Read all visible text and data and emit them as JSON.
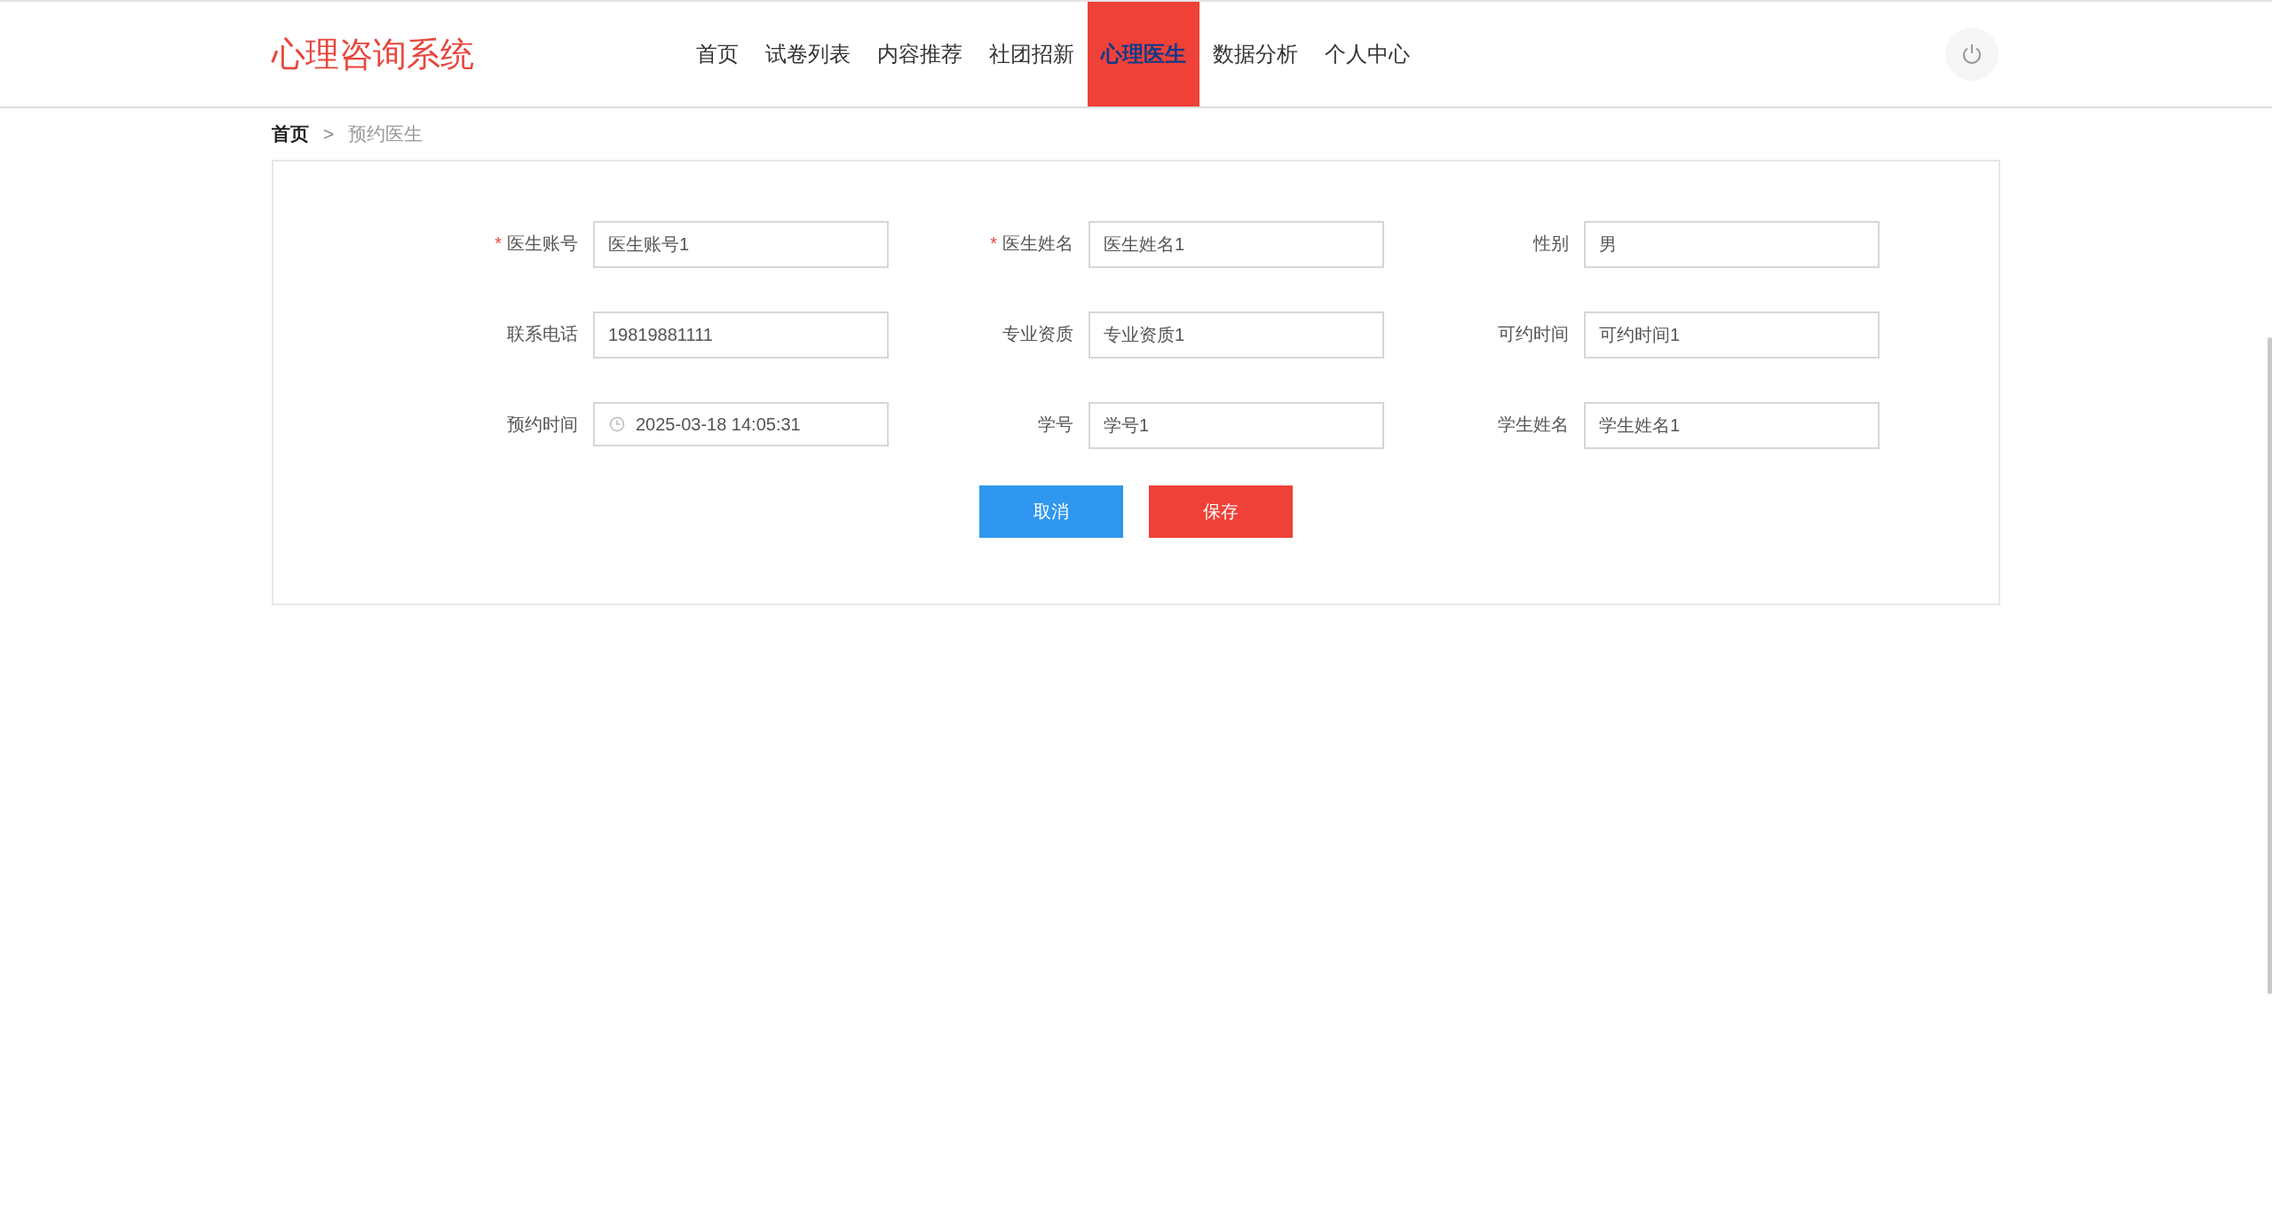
{
  "header": {
    "logo": "心理咨询系统",
    "nav": [
      {
        "label": "首页",
        "selected": false
      },
      {
        "label": "试卷列表",
        "selected": false
      },
      {
        "label": "内容推荐",
        "selected": false
      },
      {
        "label": "社团招新",
        "selected": false
      },
      {
        "label": "心理医生",
        "selected": true
      },
      {
        "label": "数据分析",
        "selected": false
      },
      {
        "label": "个人中心",
        "selected": false
      }
    ]
  },
  "breadcrumb": {
    "home": "首页",
    "separator": ">",
    "current": "预约医生"
  },
  "form": {
    "required_mark": "*",
    "fields": [
      {
        "label": "医生账号",
        "required": true,
        "kind": "text",
        "value": "医生账号1"
      },
      {
        "label": "医生姓名",
        "required": true,
        "kind": "text",
        "value": "医生姓名1"
      },
      {
        "label": "性别",
        "required": false,
        "kind": "text",
        "value": "男"
      },
      {
        "label": "联系电话",
        "required": false,
        "kind": "text",
        "value": "19819881111"
      },
      {
        "label": "专业资质",
        "required": false,
        "kind": "text",
        "value": "专业资质1"
      },
      {
        "label": "可约时间",
        "required": false,
        "kind": "text",
        "value": "可约时间1"
      },
      {
        "label": "预约时间",
        "required": false,
        "kind": "datetime",
        "value": "2025-03-18 14:05:31"
      },
      {
        "label": "学号",
        "required": false,
        "kind": "text",
        "value": "学号1"
      },
      {
        "label": "学生姓名",
        "required": false,
        "kind": "text",
        "value": "学生姓名1"
      }
    ],
    "buttons": [
      {
        "label": "取消",
        "kind": "cancel"
      },
      {
        "label": "保存",
        "kind": "save"
      }
    ]
  }
}
